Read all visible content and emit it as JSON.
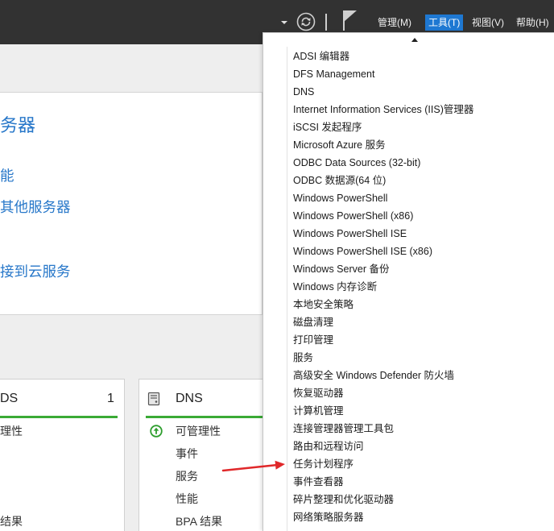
{
  "header": {
    "menu": [
      {
        "label": "管理(M)"
      },
      {
        "label": "工具(T)",
        "active": true
      },
      {
        "label": "视图(V)"
      },
      {
        "label": "帮助(H)"
      }
    ],
    "icons": [
      "chevron-down-icon",
      "refresh-icon",
      "notification-flag-icon"
    ]
  },
  "quick_start": {
    "heading": "务器",
    "links": [
      "能",
      "其他服务器",
      "接到云服务"
    ]
  },
  "tiles": [
    {
      "title": "DS",
      "count": "1",
      "rows": [
        "理性",
        "结果"
      ]
    },
    {
      "title": "DNS",
      "icon": "dns-role-icon",
      "status_icon": "status-ok-up-arrow-icon",
      "rows": [
        "可管理性",
        "事件",
        "服务",
        "性能",
        "BPA 结果"
      ]
    }
  ],
  "tools_menu": {
    "scroll_icon": "menu-scroll-up-icon",
    "items": [
      "ADSI 编辑器",
      "DFS Management",
      "DNS",
      "Internet Information Services (IIS)管理器",
      "iSCSI 发起程序",
      "Microsoft Azure 服务",
      "ODBC Data Sources (32-bit)",
      "ODBC 数据源(64 位)",
      "Windows PowerShell",
      "Windows PowerShell (x86)",
      "Windows PowerShell ISE",
      "Windows PowerShell ISE (x86)",
      "Windows Server 备份",
      "Windows 内存诊断",
      "本地安全策略",
      "磁盘清理",
      "打印管理",
      "服务",
      "高级安全 Windows Defender 防火墙",
      "恢复驱动器",
      "计算机管理",
      "连接管理器管理工具包",
      "路由和远程访问",
      "任务计划程序",
      "事件查看器",
      "碎片整理和优化驱动器",
      "网络策略服务器"
    ]
  },
  "colors": {
    "header_bg": "#323232",
    "menu_highlight": "#1e78d2",
    "link": "#2777c9",
    "status_ok": "#3aaa35",
    "annotation": "#e0282a",
    "menu_text": "#1b1b1b"
  }
}
